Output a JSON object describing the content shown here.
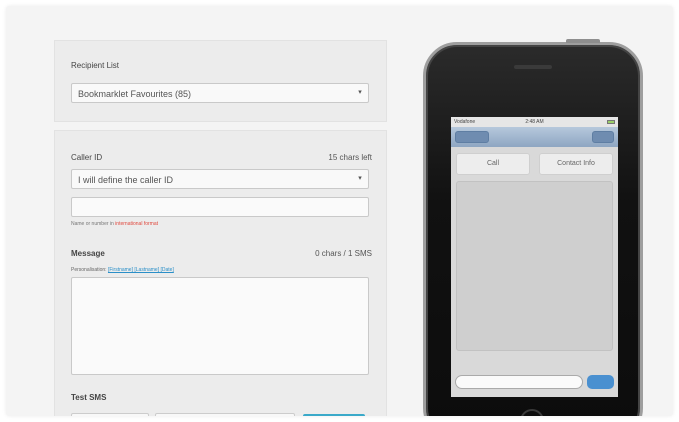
{
  "recipient": {
    "label": "Recipient List",
    "selected": "Bookmarklet Favourites (85)"
  },
  "caller": {
    "label": "Caller ID",
    "chars_left": "15 chars left",
    "selected": "I will define the caller ID",
    "hint_prefix": "Name or number in ",
    "hint_link": "international format"
  },
  "message": {
    "label": "Message",
    "counter": "0 chars / 1 SMS",
    "personalisation_label": "Personalisation: ",
    "personalisation_links": "[Firstname] [Lastname] [Date]"
  },
  "test_sms": {
    "label": "Test SMS"
  },
  "phone": {
    "carrier": "Vodafone",
    "time": "2:48 AM",
    "tab_call": "Call",
    "tab_contact": "Contact Info"
  },
  "colors": {
    "accent": "#3aa9c9",
    "link": "#2a8fc8",
    "warning": "#e0483d"
  }
}
